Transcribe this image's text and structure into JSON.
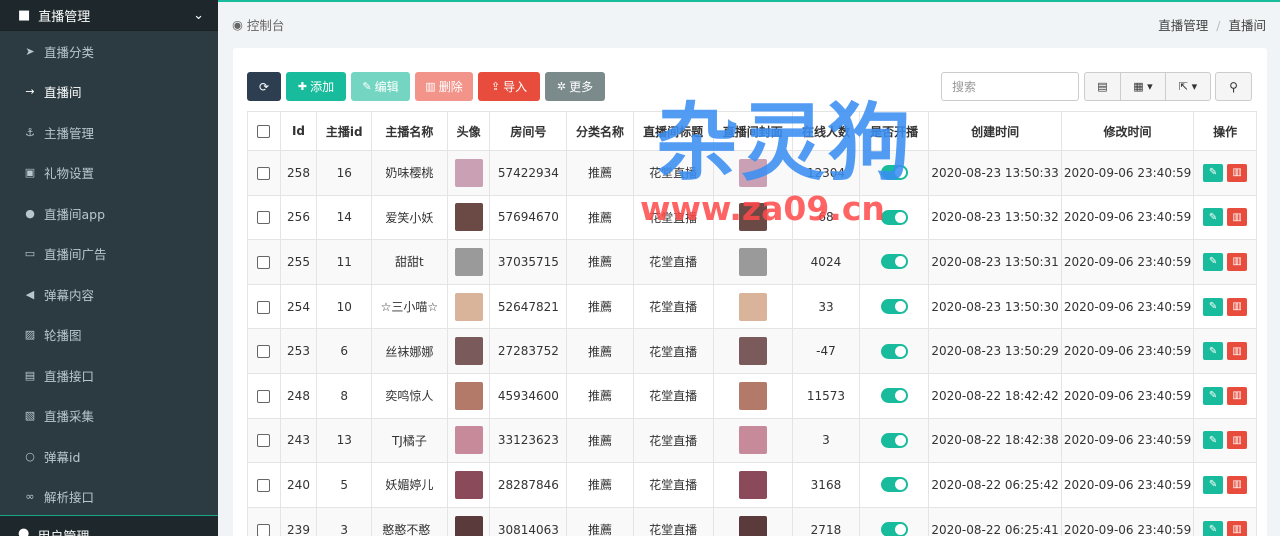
{
  "sidebar": {
    "section": "直播管理",
    "items": [
      {
        "label": "直播分类",
        "icon": "location-arrow-icon",
        "glyph": "➤",
        "active": false
      },
      {
        "label": "直播间",
        "icon": "long-arrow-right-icon",
        "glyph": "→",
        "active": true
      },
      {
        "label": "主播管理",
        "icon": "anchor-icon",
        "glyph": "⚓",
        "active": false
      },
      {
        "label": "礼物设置",
        "icon": "gift-icon",
        "glyph": "▣",
        "active": false
      },
      {
        "label": "直播间app",
        "icon": "apple-icon",
        "glyph": "●",
        "active": false
      },
      {
        "label": "直播间广告",
        "icon": "ad-icon",
        "glyph": "▭",
        "active": false
      },
      {
        "label": "弹幕内容",
        "icon": "bullhorn-icon",
        "glyph": "◀",
        "active": false
      },
      {
        "label": "轮播图",
        "icon": "image-icon",
        "glyph": "▨",
        "active": false
      },
      {
        "label": "直播接口",
        "icon": "file-code-icon",
        "glyph": "▤",
        "active": false
      },
      {
        "label": "直播采集",
        "icon": "picture-icon",
        "glyph": "▧",
        "active": false
      },
      {
        "label": "弹幕id",
        "icon": "circle-icon",
        "glyph": "○",
        "active": false
      },
      {
        "label": "解析接口",
        "icon": "link-icon",
        "glyph": "∞",
        "active": false
      }
    ],
    "next_section": "用户管理"
  },
  "header": {
    "title": "控制台",
    "breadcrumb": [
      "直播管理",
      "直播间"
    ]
  },
  "toolbar": {
    "add": "添加",
    "edit": "编辑",
    "delete": "删除",
    "import": "导入",
    "more": "更多",
    "search_placeholder": "搜索"
  },
  "table": {
    "columns": [
      "Id",
      "主播id",
      "主播名称",
      "头像",
      "房间号",
      "分类名称",
      "直播间标题",
      "直播间封面",
      "在线人数",
      "是否开播",
      "创建时间",
      "修改时间",
      "操作"
    ],
    "rows": [
      {
        "id": "258",
        "anchor_id": "16",
        "name": "奶味樱桃",
        "room": "57422934",
        "category": "推薦",
        "title": "花堂直播",
        "online": "12304",
        "created": "2020-08-23 13:50:33",
        "updated": "2020-09-06 23:40:59",
        "color": "#c9a0b4"
      },
      {
        "id": "256",
        "anchor_id": "14",
        "name": "爱笑小妖",
        "room": "57694670",
        "category": "推薦",
        "title": "花堂直播",
        "online": "68",
        "created": "2020-08-23 13:50:32",
        "updated": "2020-09-06 23:40:59",
        "color": "#6b4a45"
      },
      {
        "id": "255",
        "anchor_id": "11",
        "name": "甜甜t",
        "room": "37035715",
        "category": "推薦",
        "title": "花堂直播",
        "online": "4024",
        "created": "2020-08-23 13:50:31",
        "updated": "2020-09-06 23:40:59",
        "color": "#9a9a9a"
      },
      {
        "id": "254",
        "anchor_id": "10",
        "name": "☆三小喵☆",
        "room": "52647821",
        "category": "推薦",
        "title": "花堂直播",
        "online": "33",
        "created": "2020-08-23 13:50:30",
        "updated": "2020-09-06 23:40:59",
        "color": "#d9b49a"
      },
      {
        "id": "253",
        "anchor_id": "6",
        "name": "丝袜娜娜",
        "room": "27283752",
        "category": "推薦",
        "title": "花堂直播",
        "online": "-47",
        "created": "2020-08-23 13:50:29",
        "updated": "2020-09-06 23:40:59",
        "color": "#7a5a5a"
      },
      {
        "id": "248",
        "anchor_id": "8",
        "name": "奕鸣惊人",
        "room": "45934600",
        "category": "推薦",
        "title": "花堂直播",
        "online": "11573",
        "created": "2020-08-22 18:42:42",
        "updated": "2020-09-06 23:40:59",
        "color": "#b37a6a"
      },
      {
        "id": "243",
        "anchor_id": "13",
        "name": "TJ橘子",
        "room": "33123623",
        "category": "推薦",
        "title": "花堂直播",
        "online": "3",
        "created": "2020-08-22 18:42:38",
        "updated": "2020-09-06 23:40:59",
        "color": "#c78a9a"
      },
      {
        "id": "240",
        "anchor_id": "5",
        "name": "妖媚婷儿",
        "room": "28287846",
        "category": "推薦",
        "title": "花堂直播",
        "online": "3168",
        "created": "2020-08-22 06:25:42",
        "updated": "2020-09-06 23:40:59",
        "color": "#8a4a5a"
      },
      {
        "id": "239",
        "anchor_id": "3",
        "name": "憨憨不憨_",
        "room": "30814063",
        "category": "推薦",
        "title": "花堂直播",
        "online": "2718",
        "created": "2020-08-22 06:25:41",
        "updated": "2020-09-06 23:40:59",
        "color": "#5a3a3a"
      }
    ]
  },
  "watermark": {
    "line1": "杂灵狗",
    "line2": "www.za09.cn"
  },
  "colors": {
    "accent": "#18bc9c",
    "danger": "#e74c3c",
    "sidebar": "#222d32"
  }
}
